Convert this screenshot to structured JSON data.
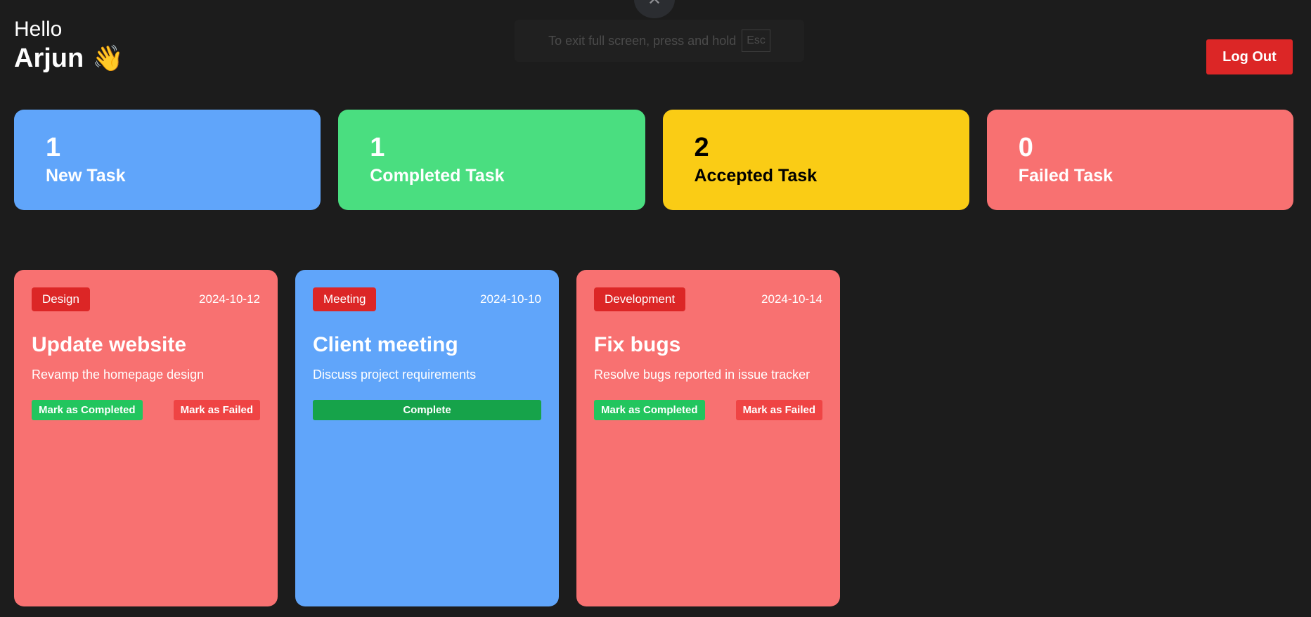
{
  "header": {
    "greeting": "Hello",
    "username": "Arjun",
    "wave_emoji": "👋",
    "logout_label": "Log Out"
  },
  "fullscreen_notice": {
    "text": "To exit full screen, press and hold",
    "key": "Esc",
    "close_glyph": "✕"
  },
  "stats": [
    {
      "count": "1",
      "label": "New Task",
      "color": "#60a5fa",
      "text_color": "#ffffff"
    },
    {
      "count": "1",
      "label": "Completed Task",
      "color": "#4ade80",
      "text_color": "#ffffff"
    },
    {
      "count": "2",
      "label": "Accepted Task",
      "color": "#facc15",
      "text_color": "#000000"
    },
    {
      "count": "0",
      "label": "Failed Task",
      "color": "#f87171",
      "text_color": "#ffffff"
    }
  ],
  "tasks": [
    {
      "category": "Design",
      "date": "2024-10-12",
      "title": "Update website",
      "description": "Revamp the homepage design",
      "color": "#f87171",
      "completed_label": "Mark as Completed",
      "failed_label": "Mark as Failed"
    },
    {
      "category": "Meeting",
      "date": "2024-10-10",
      "title": "Client meeting",
      "description": "Discuss project requirements",
      "color": "#60a5fa",
      "complete_label": "Complete"
    },
    {
      "category": "Development",
      "date": "2024-10-14",
      "title": "Fix bugs",
      "description": "Resolve bugs reported in issue tracker",
      "color": "#f87171",
      "completed_label": "Mark as Completed",
      "failed_label": "Mark as Failed"
    }
  ]
}
